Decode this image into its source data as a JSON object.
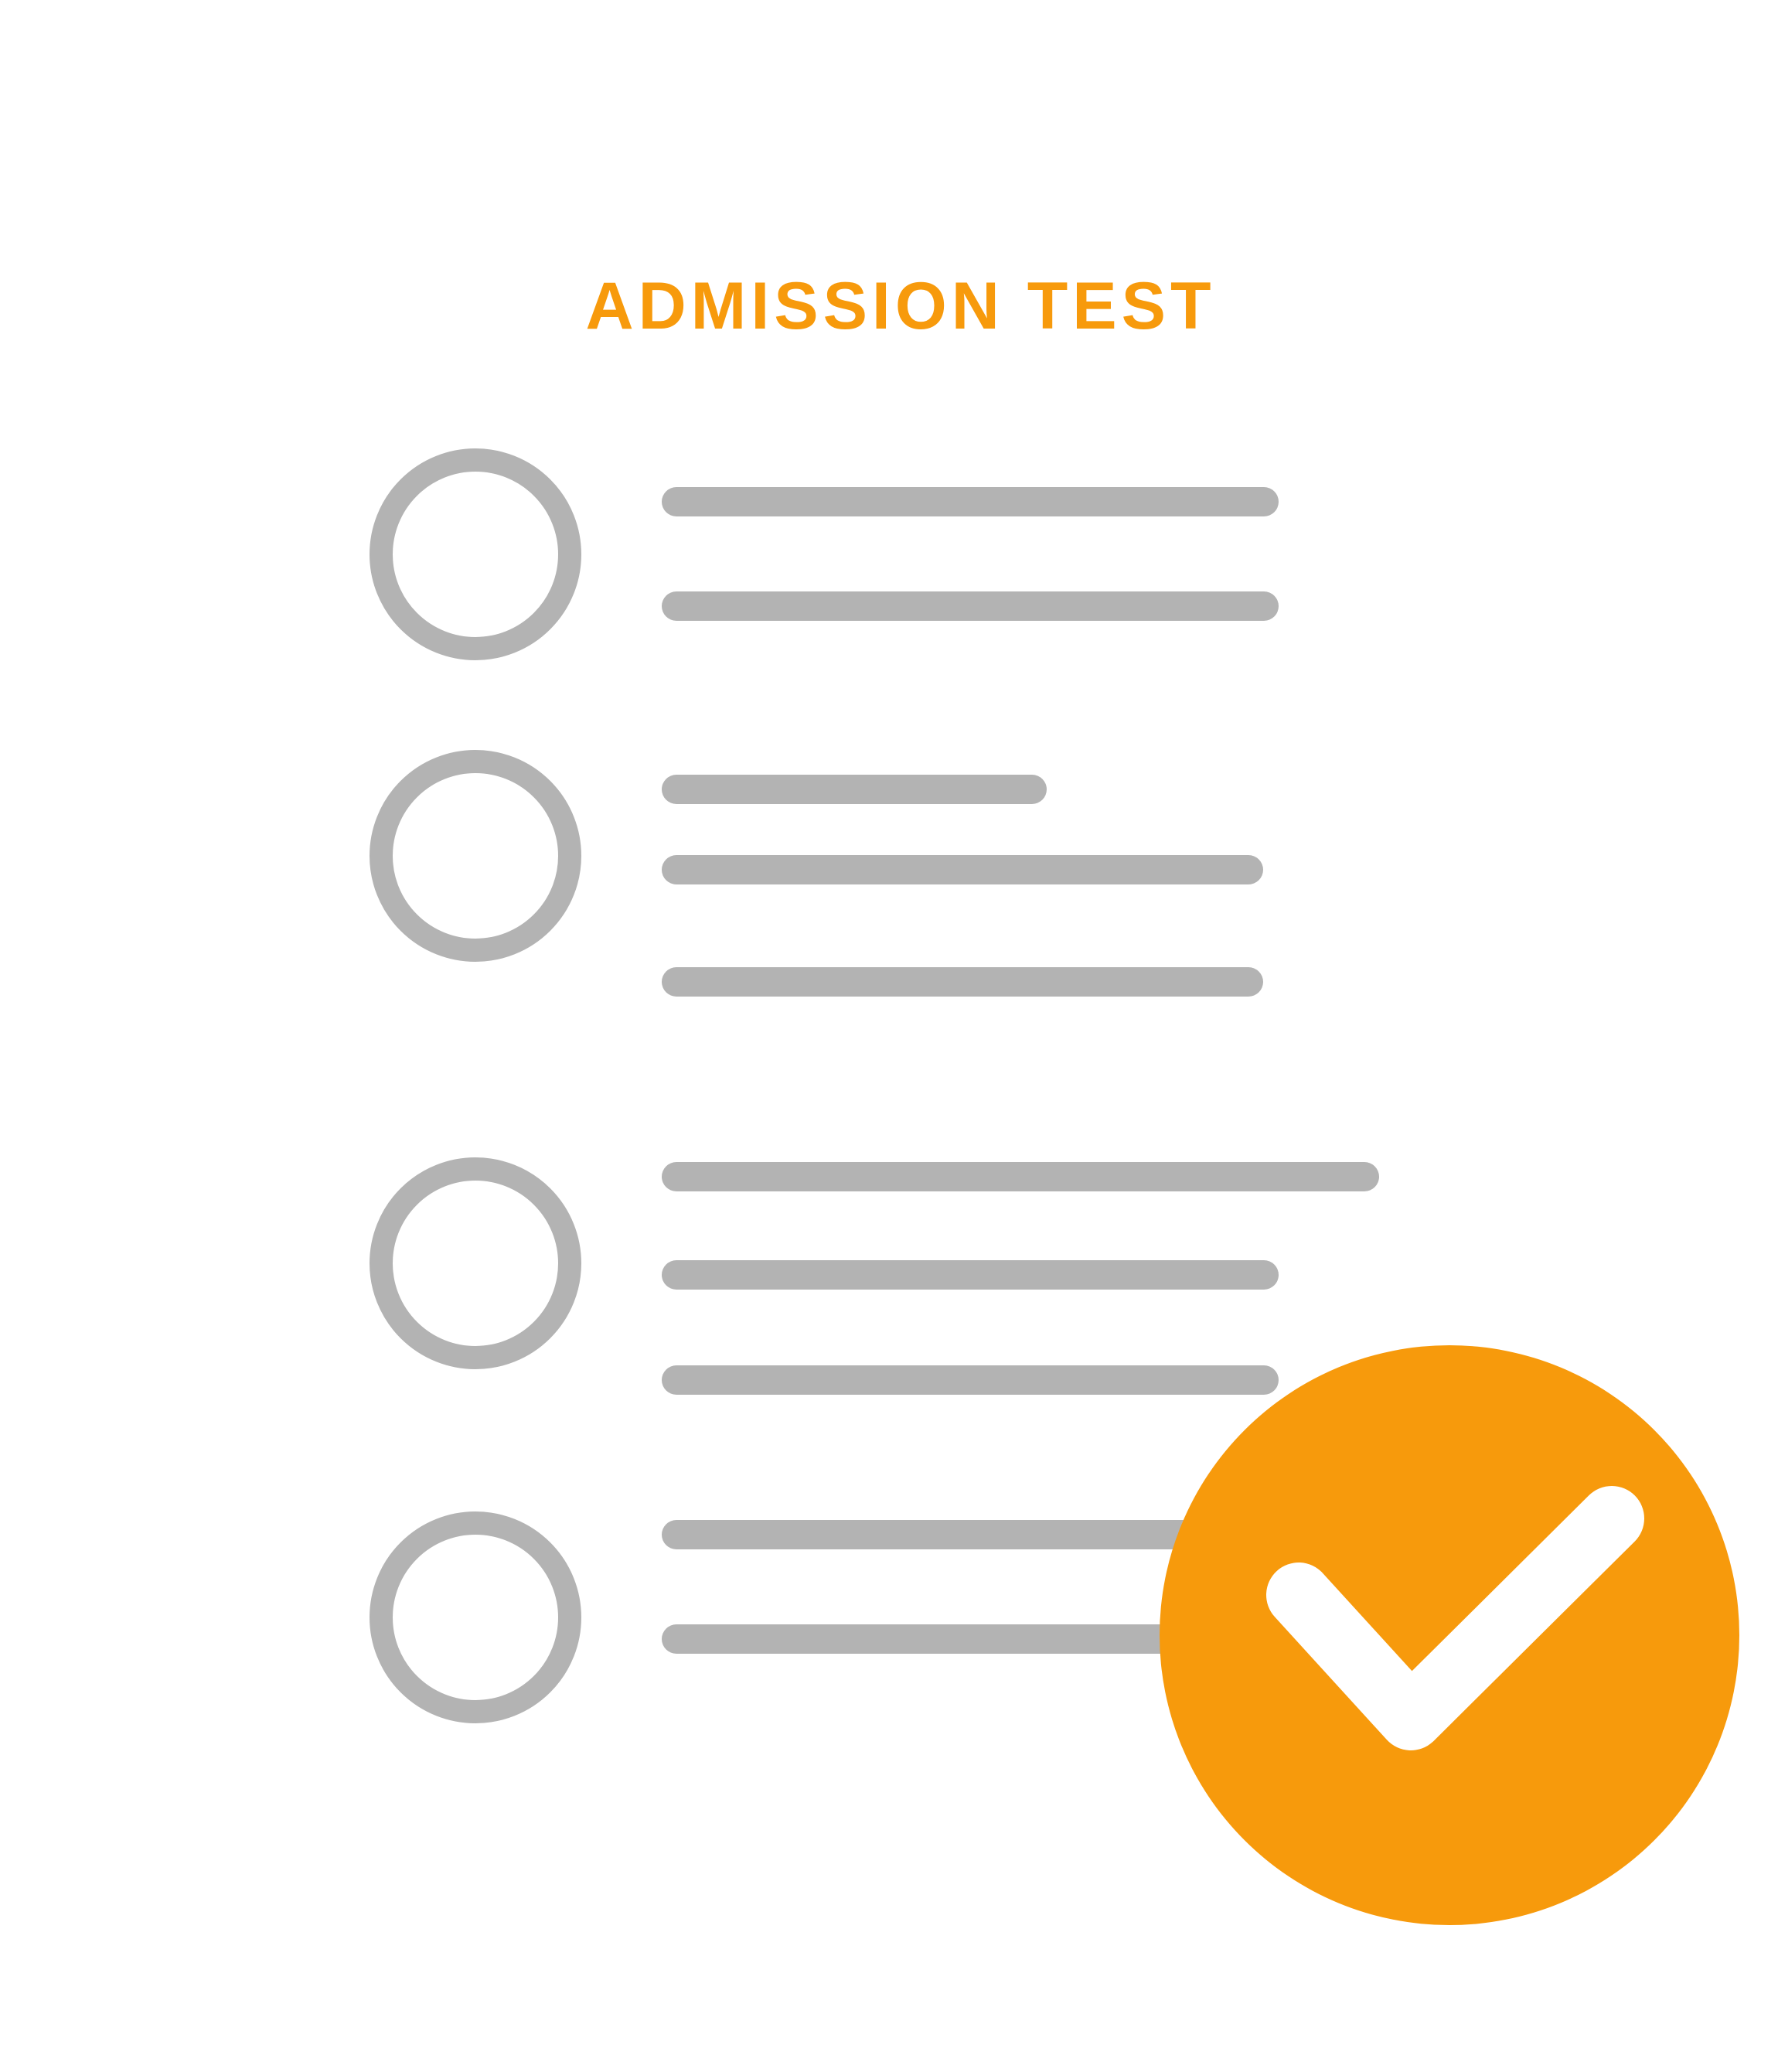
{
  "document": {
    "title": "ADMISSION TEST"
  },
  "colors": {
    "page_background": "#ffffff",
    "sheet_background": "#ffffff",
    "accent": "#f79a0c",
    "line_gray": "#b3b3b3",
    "check_mark": "#ffffff"
  },
  "questions": [
    {
      "id": "q1",
      "answer_lines": 2
    },
    {
      "id": "q2",
      "answer_lines": 3
    },
    {
      "id": "q3",
      "answer_lines": 3
    },
    {
      "id": "q4",
      "answer_lines": 2
    }
  ],
  "status_badge": {
    "icon": "check-circle-icon"
  }
}
